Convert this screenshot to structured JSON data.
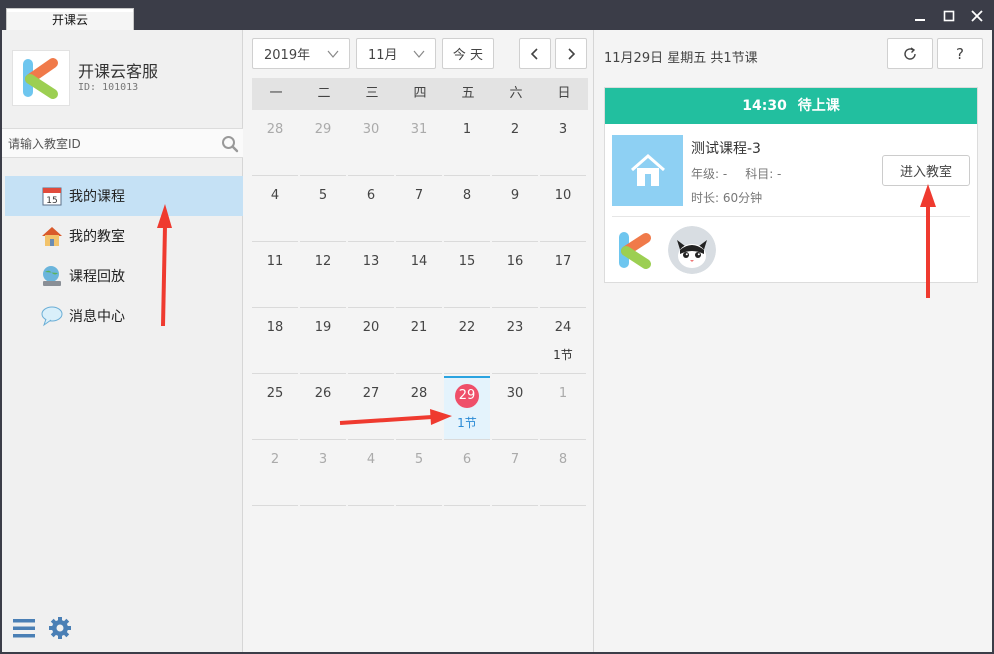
{
  "window": {
    "tab_title": "开课云",
    "controls": {
      "minimize": "minimize-icon",
      "maximize": "maximize-icon",
      "close": "close-icon"
    }
  },
  "sidebar": {
    "profile": {
      "name": "开课云客服",
      "id_text": "ID: 101013"
    },
    "search": {
      "placeholder": "请输入教室ID",
      "value": ""
    },
    "items": [
      {
        "label": "我的课程",
        "icon": "calendar-icon",
        "active": true
      },
      {
        "label": "我的教室",
        "icon": "house-icon",
        "active": false
      },
      {
        "label": "课程回放",
        "icon": "playback-globe-icon",
        "active": false
      },
      {
        "label": "消息中心",
        "icon": "chat-bubble-icon",
        "active": false
      }
    ],
    "bottom_icons": [
      "menu-icon",
      "settings-icon"
    ]
  },
  "calendar": {
    "year": "2019年",
    "month": "11月",
    "today_label": "今 天",
    "weekdays": [
      "一",
      "二",
      "三",
      "四",
      "五",
      "六",
      "日"
    ],
    "today": 29,
    "weeks": [
      [
        {
          "d": "28",
          "o": true
        },
        {
          "d": "29",
          "o": true
        },
        {
          "d": "30",
          "o": true
        },
        {
          "d": "31",
          "o": true
        },
        {
          "d": "1"
        },
        {
          "d": "2"
        },
        {
          "d": "3"
        }
      ],
      [
        {
          "d": "4"
        },
        {
          "d": "5"
        },
        {
          "d": "6"
        },
        {
          "d": "7"
        },
        {
          "d": "8"
        },
        {
          "d": "9"
        },
        {
          "d": "10"
        }
      ],
      [
        {
          "d": "11"
        },
        {
          "d": "12"
        },
        {
          "d": "13"
        },
        {
          "d": "14"
        },
        {
          "d": "15"
        },
        {
          "d": "16"
        },
        {
          "d": "17"
        }
      ],
      [
        {
          "d": "18"
        },
        {
          "d": "19"
        },
        {
          "d": "20"
        },
        {
          "d": "21"
        },
        {
          "d": "22"
        },
        {
          "d": "23"
        },
        {
          "d": "24",
          "b": "1节"
        }
      ],
      [
        {
          "d": "25"
        },
        {
          "d": "26"
        },
        {
          "d": "27"
        },
        {
          "d": "28"
        },
        {
          "d": "29",
          "t": true,
          "b": "1节"
        },
        {
          "d": "30"
        },
        {
          "d": "1",
          "o": true
        }
      ],
      [
        {
          "d": "2",
          "o": true
        },
        {
          "d": "3",
          "o": true
        },
        {
          "d": "4",
          "o": true
        },
        {
          "d": "5",
          "o": true
        },
        {
          "d": "6",
          "o": true
        },
        {
          "d": "7",
          "o": true
        },
        {
          "d": "8",
          "o": true
        }
      ]
    ]
  },
  "detail": {
    "date_summary": "11月29日 星期五 共1节课",
    "refresh_icon": "refresh-icon",
    "help_label": "?",
    "course": {
      "time": "14:30",
      "status": "待上课",
      "title": "测试课程-3",
      "grade": "年级: -",
      "subject": "科目: -",
      "duration": "时长: 60分钟",
      "enter_label": "进入教室"
    }
  },
  "colors": {
    "accent_green": "#22bf9f",
    "today_red": "#ef4f6a",
    "active_nav": "#c5e1f5",
    "annotation_arrow": "#ef3a2f"
  }
}
